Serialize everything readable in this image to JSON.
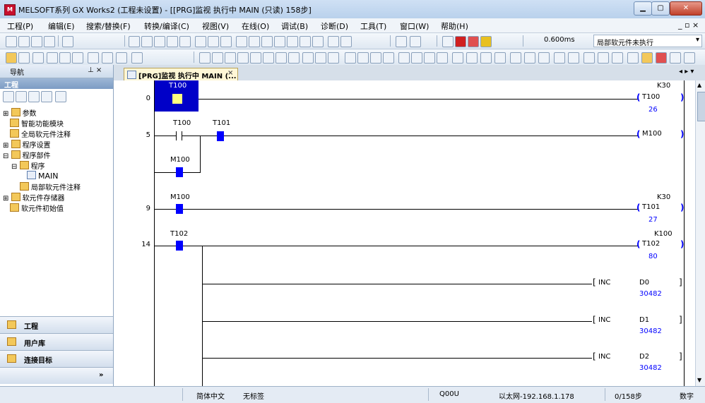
{
  "window": {
    "title": "MELSOFT系列 GX Works2 (工程未设置) - [[PRG]监视 执行中 MAIN (只读) 158步]",
    "app_icon": "MELSOFT"
  },
  "menu": [
    "工程(P)",
    "编辑(E)",
    "搜索/替换(F)",
    "转换/编译(C)",
    "视图(V)",
    "在线(O)",
    "调试(B)",
    "诊断(D)",
    "工具(T)",
    "窗口(W)",
    "帮助(H)"
  ],
  "toolbar": {
    "scan_time": "0.600ms",
    "comment_mode": "局部软元件未执行"
  },
  "nav": {
    "title": "导航",
    "pin": "⊥ ×",
    "section": "工程",
    "tree": [
      {
        "label": "参数",
        "level": 0
      },
      {
        "label": "智能功能模块",
        "level": 1
      },
      {
        "label": "全局软元件注释",
        "level": 1
      },
      {
        "label": "程序设置",
        "level": 0
      },
      {
        "label": "程序部件",
        "level": 0
      },
      {
        "label": "程序",
        "level": 1
      },
      {
        "label": "MAIN",
        "level": 2
      },
      {
        "label": "局部软元件注释",
        "level": 1
      },
      {
        "label": "软元件存储器",
        "level": 0
      },
      {
        "label": "软元件初始值",
        "level": 1
      }
    ],
    "buttons": [
      "工程",
      "用户库",
      "连接目标"
    ],
    "more": "»"
  },
  "tab": {
    "label": "[PRG]监视 执行中 MAIN (...",
    "close": "×",
    "nav_arrows": "◂ ▸ ▾"
  },
  "ladder": {
    "rungs": [
      {
        "step": "0",
        "contact": "T100",
        "coil": "T100",
        "setpoint": "K30",
        "current": "26"
      },
      {
        "step": "5",
        "contacts": [
          "T100",
          "T101"
        ],
        "branch": "M100",
        "coil": "M100"
      },
      {
        "step": "9",
        "contact": "M100",
        "coil": "T101",
        "setpoint": "K30",
        "current": "27"
      },
      {
        "step": "14",
        "contact": "T102",
        "coil": "T102",
        "setpoint": "K100",
        "current": "80"
      }
    ],
    "inc": [
      {
        "op": "INC",
        "dev": "D0",
        "val": "30482"
      },
      {
        "op": "INC",
        "dev": "D1",
        "val": "30482"
      },
      {
        "op": "INC",
        "dev": "D2",
        "val": "30482"
      }
    ]
  },
  "statusbar": {
    "lang": "简体中文",
    "label": "无标签",
    "cpu": "Q00U",
    "conn": "以太网-192.168.1.178",
    "steps": "0/158步",
    "num": "数字"
  },
  "colors": {
    "ladder_blue": "#0000ff",
    "selected_bg": "#0000c8",
    "contact_on": "#ffff80"
  }
}
